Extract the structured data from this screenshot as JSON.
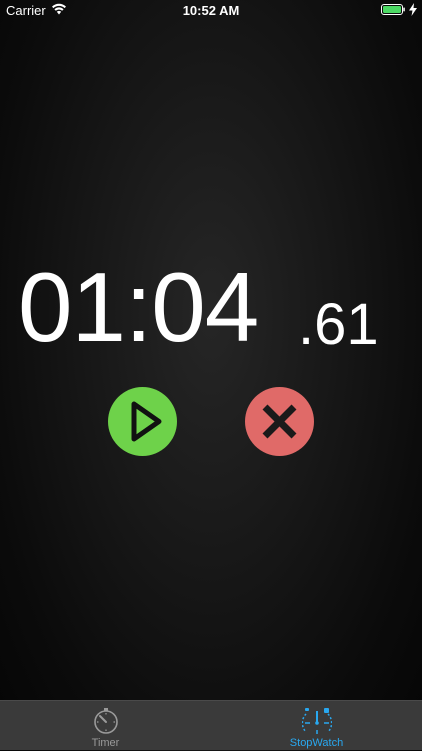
{
  "status_bar": {
    "carrier": "Carrier",
    "time": "10:52 AM",
    "wifi_icon": "wifi-icon",
    "battery_icon": "battery-icon",
    "charging_icon": "charging-bolt-icon",
    "battery_color": "#4cd964"
  },
  "stopwatch": {
    "time_main": "01:04",
    "time_hundredths": ".61"
  },
  "controls": {
    "play": {
      "icon": "play-icon",
      "color": "#6ed24a"
    },
    "reset": {
      "icon": "close-icon",
      "color": "#e06a68"
    }
  },
  "tab_bar": {
    "tabs": [
      {
        "label": "Timer",
        "icon": "timer-icon",
        "active": false
      },
      {
        "label": "StopWatch",
        "icon": "stopwatch-icon",
        "active": true
      }
    ],
    "active_color": "#29a8f0",
    "inactive_color": "#9a9a9a"
  }
}
